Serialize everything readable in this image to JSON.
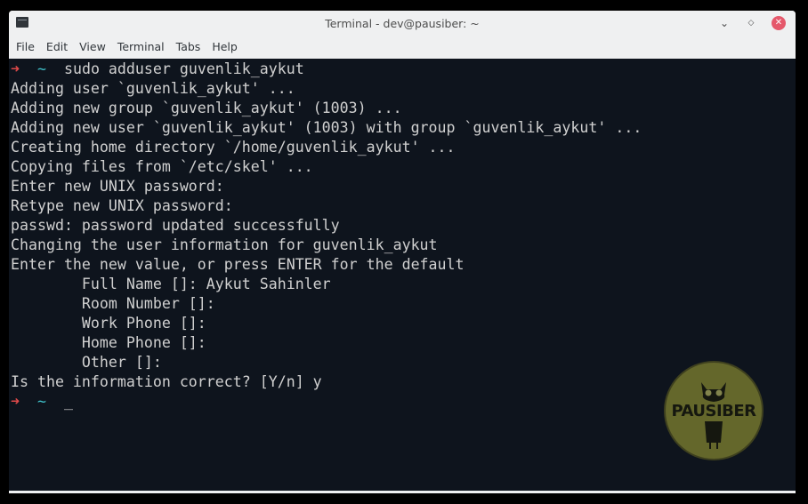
{
  "window": {
    "title": "Terminal - dev@pausiber: ~",
    "buttons": {
      "minimize": "⌄",
      "maximize": "◇",
      "close": "✕"
    }
  },
  "menu": [
    "File",
    "Edit",
    "View",
    "Terminal",
    "Tabs",
    "Help"
  ],
  "terminal": {
    "prompt_symbol": "➜",
    "prompt_dir": "~",
    "command": "sudo adduser guvenlik_aykut",
    "output": [
      "Adding user `guvenlik_aykut' ...",
      "Adding new group `guvenlik_aykut' (1003) ...",
      "Adding new user `guvenlik_aykut' (1003) with group `guvenlik_aykut' ...",
      "Creating home directory `/home/guvenlik_aykut' ...",
      "Copying files from `/etc/skel' ...",
      "Enter new UNIX password:",
      "Retype new UNIX password:",
      "passwd: password updated successfully",
      "Changing the user information for guvenlik_aykut",
      "Enter the new value, or press ENTER for the default",
      "        Full Name []: Aykut Sahinler",
      "        Room Number []:",
      "        Work Phone []:",
      "        Home Phone []:",
      "        Other []:",
      "Is the information correct? [Y/n] y"
    ],
    "cursor": "_"
  },
  "watermark": {
    "text": "PAUSIBER",
    "icon": "owl-icon",
    "color": "#9a9a35"
  },
  "colors": {
    "terminal_bg": "#0e141d",
    "terminal_fg": "#d0d0d0",
    "prompt_arrow": "#e04a4a",
    "prompt_dir": "#3fc0c9",
    "close_button": "#e5586b"
  }
}
